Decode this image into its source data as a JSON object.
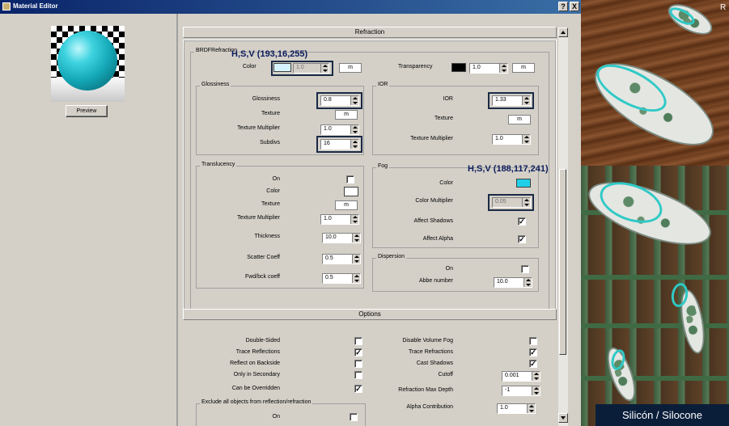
{
  "window": {
    "title": "Material Editor",
    "help_button": "?",
    "close_button": "X"
  },
  "left": {
    "preview_button": "Preview"
  },
  "refraction": {
    "header": "Refraction",
    "brdf_group": "BRDFRefraction",
    "color_label": "Color",
    "color_value": "1.0",
    "color_map": "m",
    "transparency_label": "Transparency",
    "transparency_value": "1.0",
    "transparency_map": "m",
    "glossiness": {
      "group": "Glossiness",
      "glossiness_label": "Glossiness",
      "glossiness_value": "0.8",
      "texture_label": "Texture",
      "texture_map": "m",
      "texmult_label": "Texture Multiplier",
      "texmult_value": "1.0",
      "subdivs_label": "Subdivs",
      "subdivs_value": "16"
    },
    "ior": {
      "group": "IOR",
      "ior_label": "IOR",
      "ior_value": "1.33",
      "texture_label": "Texture",
      "texture_map": "m",
      "texmult_label": "Texture Multiplier",
      "texmult_value": "1.0"
    },
    "translucency": {
      "group": "Translucency",
      "on_label": "On",
      "color_label": "Color",
      "texture_label": "Texture",
      "texture_map": "m",
      "texmult_label": "Texture Multiplier",
      "texmult_value": "1.0",
      "thickness_label": "Thickness",
      "thickness_value": "10.0",
      "scatter_label": "Scatter Coeff",
      "scatter_value": "0.5",
      "fwdbck_label": "Fwd/bck coeff",
      "fwdbck_value": "0.5"
    },
    "fog": {
      "group": "Fog",
      "color_label": "Color",
      "color_swatch": "#20d0e8",
      "mult_label": "Color Multiplier",
      "mult_value": "0.05",
      "affect_shadows_label": "Affect Shadows",
      "affect_shadows_checked": "✓",
      "affect_alpha_label": "Affect Alpha",
      "affect_alpha_checked": "✓"
    },
    "dispersion": {
      "group": "Dispersion",
      "on_label": "On",
      "abbe_label": "Abbe number",
      "abbe_value": "10.0"
    }
  },
  "annotations": {
    "color_hsv": "H,S,V (193,16,255)",
    "fog_hsv": "H,S,V (188,117,241)"
  },
  "options": {
    "header": "Options",
    "left": [
      {
        "label": "Double-Sided",
        "mark": ""
      },
      {
        "label": "Trace Reflections",
        "mark": "✓"
      },
      {
        "label": "Reflect on Backside",
        "mark": ""
      },
      {
        "label": "Only in Secondary",
        "mark": ""
      },
      {
        "label": "Can be Overridden",
        "mark": "✓"
      }
    ],
    "right_checks": [
      {
        "label": "Disable Volume Fog",
        "mark": ""
      },
      {
        "label": "Trace Refractions",
        "mark": "✓"
      },
      {
        "label": "Cast Shadows",
        "mark": "✓"
      }
    ],
    "cutoff_label": "Cutoff",
    "cutoff_value": "0.001",
    "max_depth_label": "Refraction Max Depth",
    "max_depth_value": "-1",
    "alpha_label": "Alpha Contribution",
    "alpha_value": "1.0",
    "exclude_group": "Exclude all objects from reflection/refraction",
    "exclude_on_label": "On"
  },
  "render": {
    "caption": "Silicón / Silocone",
    "mark": "R"
  },
  "colors": {
    "title_bar": "#0a246a",
    "panel": "#d4d0c8",
    "highlight": "#1a2a45",
    "fog": "#20d0e8"
  }
}
